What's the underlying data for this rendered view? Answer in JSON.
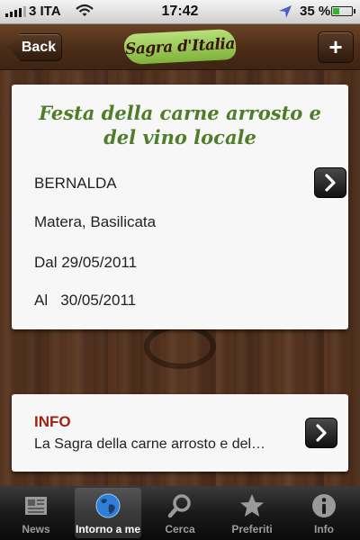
{
  "status_bar": {
    "carrier": "3 ITA",
    "time": "17:42",
    "battery_percent": "35 %",
    "battery_level": 0.35
  },
  "nav_bar": {
    "back_label": "Back",
    "logo_text": "Sagra d'Italia",
    "add_label": "+"
  },
  "event": {
    "title": "Festa della carne arrosto e del vino locale",
    "town": "BERNALDA",
    "region": "Matera, Basilicata",
    "date_from": "Dal 29/05/2011",
    "date_to": "Al   30/05/2011"
  },
  "info": {
    "heading": "INFO",
    "text": "La Sagra della carne arrosto e del…"
  },
  "tabs": [
    {
      "label": "News",
      "icon": "newspaper-icon"
    },
    {
      "label": "Intorno a me",
      "icon": "globe-icon"
    },
    {
      "label": "Cerca",
      "icon": "search-icon"
    },
    {
      "label": "Preferiti",
      "icon": "star-icon"
    },
    {
      "label": "Info",
      "icon": "info-icon"
    }
  ],
  "selected_tab": "Intorno a me",
  "colors": {
    "title_green": "#4f7d2a",
    "info_red": "#a0210e",
    "wood": "#4b2d1b"
  }
}
